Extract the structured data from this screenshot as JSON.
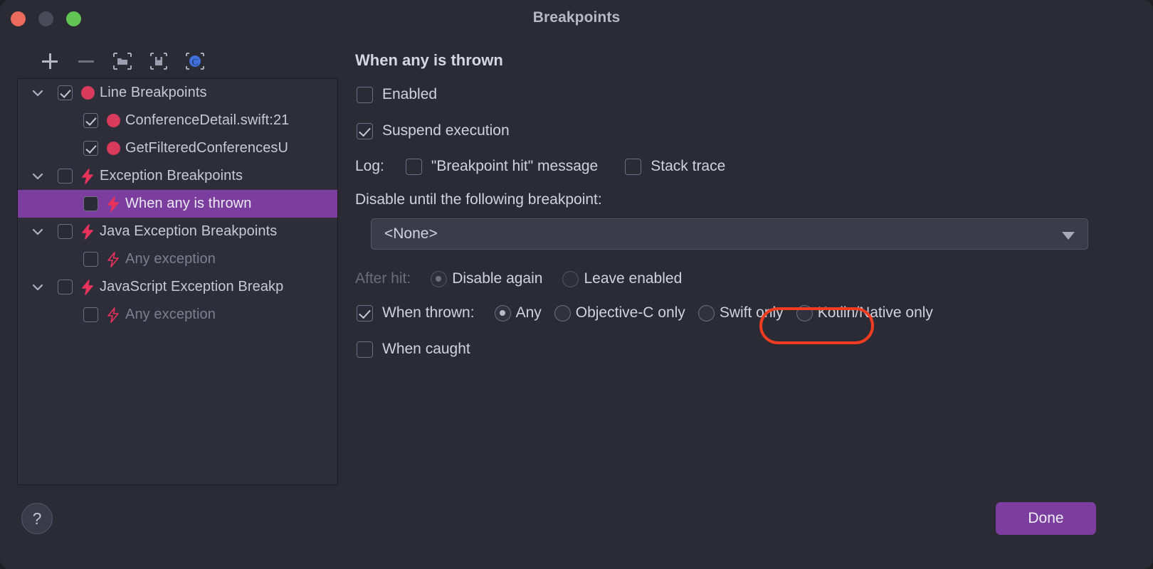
{
  "window": {
    "title": "Breakpoints",
    "traffic_lights": [
      "close",
      "minimize",
      "maximize"
    ]
  },
  "toolbar": {
    "add_label": "+",
    "remove_label": "−",
    "buttons": [
      {
        "name": "add-breakpoint-button",
        "icon": "plus-icon"
      },
      {
        "name": "remove-breakpoint-button",
        "icon": "minus-icon"
      },
      {
        "name": "group-breakpoints-button",
        "icon": "folder-icon"
      },
      {
        "name": "save-breakpoints-button",
        "icon": "save-icon"
      },
      {
        "name": "objective-c-breakpoints-button",
        "icon": "objc-icon"
      }
    ]
  },
  "tree": {
    "items": [
      {
        "label": "Line Breakpoints",
        "level": 0,
        "checked": true,
        "icon": "breakpoint-dot-icon",
        "twisty": true,
        "selected": false,
        "dim": false
      },
      {
        "label": "ConferenceDetail.swift:21",
        "level": 1,
        "checked": true,
        "icon": "breakpoint-dot-icon",
        "twisty": false,
        "selected": false,
        "dim": false
      },
      {
        "label": "GetFilteredConferencesU",
        "level": 1,
        "checked": true,
        "icon": "breakpoint-dot-icon",
        "twisty": false,
        "selected": false,
        "dim": false
      },
      {
        "label": "Exception Breakpoints",
        "level": 0,
        "checked": false,
        "icon": "bolt-icon",
        "twisty": true,
        "selected": false,
        "dim": false
      },
      {
        "label": "When any is thrown",
        "level": 1,
        "checked": false,
        "icon": "bolt-icon",
        "twisty": false,
        "selected": true,
        "dim": false
      },
      {
        "label": "Java Exception Breakpoints",
        "level": 0,
        "checked": false,
        "icon": "bolt-icon",
        "twisty": true,
        "selected": false,
        "dim": false
      },
      {
        "label": "Any exception",
        "level": 1,
        "checked": false,
        "icon": "bolt-icon",
        "twisty": false,
        "selected": false,
        "dim": true
      },
      {
        "label": "JavaScript Exception Breakp",
        "level": 0,
        "checked": false,
        "icon": "bolt-icon",
        "twisty": true,
        "selected": false,
        "dim": false
      },
      {
        "label": "Any exception",
        "level": 1,
        "checked": false,
        "icon": "bolt-icon",
        "twisty": false,
        "selected": false,
        "dim": true
      }
    ]
  },
  "help": {
    "label": "?"
  },
  "detail": {
    "title": "When any is thrown",
    "enabled": {
      "label": "Enabled",
      "checked": false
    },
    "suspend": {
      "label": "Suspend execution",
      "checked": true
    },
    "log": {
      "prefix": "Log:",
      "message": {
        "label": "\"Breakpoint hit\" message",
        "checked": false
      },
      "stack_trace": {
        "label": "Stack trace",
        "checked": false
      }
    },
    "disable_until": {
      "label": "Disable until the following breakpoint:"
    },
    "combo": {
      "value": "<None>",
      "arrow_icon": "chevron-down-icon"
    },
    "after_hit": {
      "prefix": "After hit:",
      "options": [
        {
          "label": "Disable again",
          "selected": true
        },
        {
          "label": "Leave enabled",
          "selected": false
        }
      ],
      "disabled": true
    },
    "when_thrown": {
      "label": "When thrown:",
      "checked": true,
      "options": [
        {
          "label": "Any",
          "selected": true
        },
        {
          "label": "Objective-C only",
          "selected": false
        },
        {
          "label": "Swift only",
          "selected": false
        },
        {
          "label": "Kotlin/Native only",
          "selected": false
        }
      ]
    },
    "when_caught": {
      "label": "When caught",
      "checked": false
    }
  },
  "annotation": {
    "target": "Swift only",
    "color": "#f03c20"
  },
  "footer": {
    "done_label": "Done"
  },
  "colors": {
    "window_bg": "#2b2b35",
    "panel_bg": "#2e2e3a",
    "accent_purple": "#7b3d9e",
    "breakpoint_red": "#d93b5c",
    "annotation_red": "#f03c20",
    "text": "#d2d2de",
    "text_dim": "#6c6c7e"
  }
}
